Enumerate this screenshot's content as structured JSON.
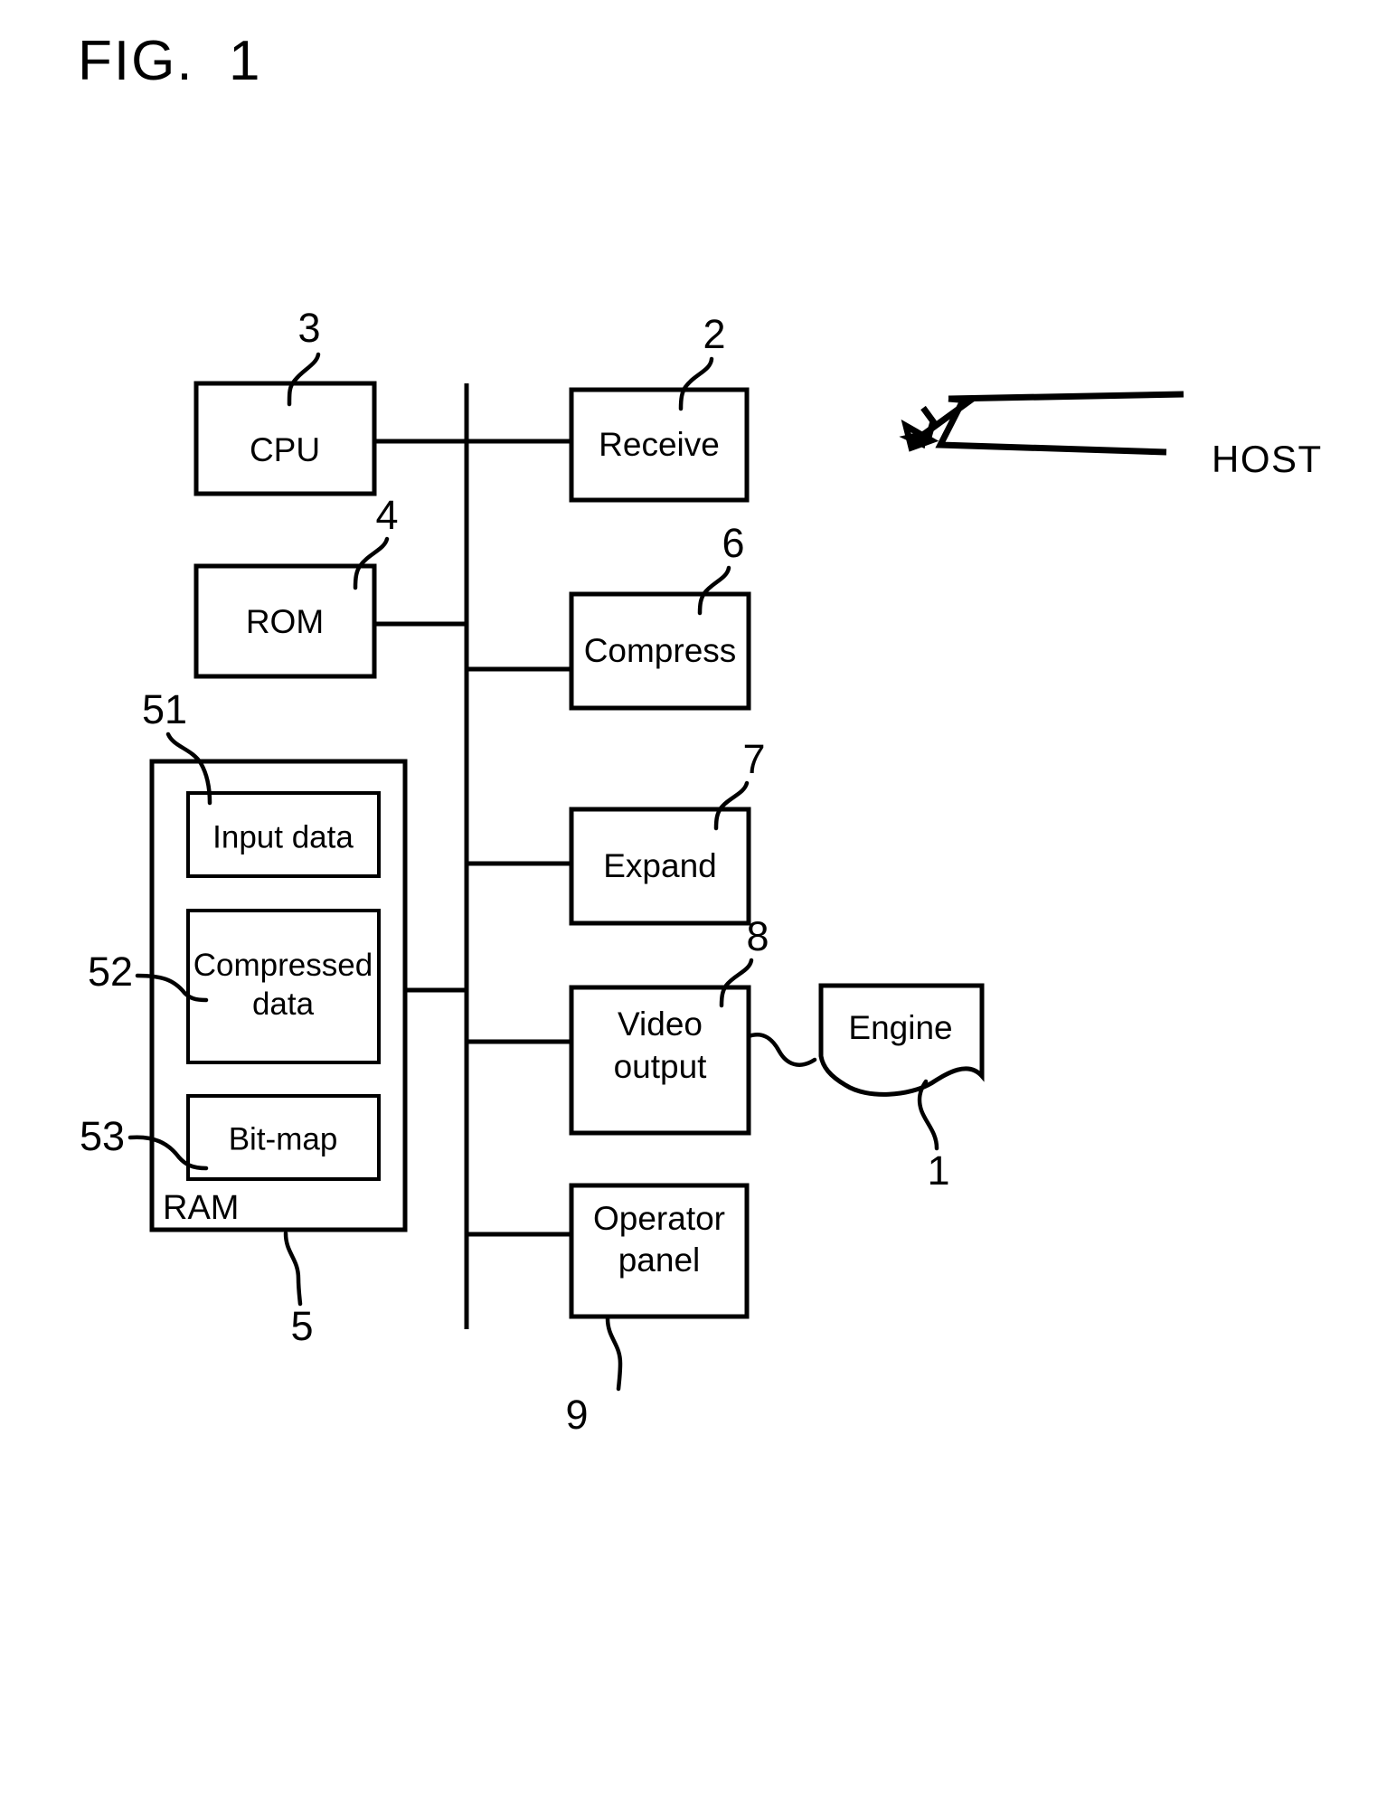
{
  "figure": {
    "title": "FIG.  1",
    "caption_number": "1"
  },
  "external": {
    "host_label": "HOST"
  },
  "blocks": [
    {
      "id": "cpu",
      "label": "CPU",
      "ref": "3"
    },
    {
      "id": "rom",
      "label": "ROM",
      "ref": "4"
    },
    {
      "id": "receive",
      "label": "Receive",
      "ref": "2"
    },
    {
      "id": "compress",
      "label": "Compress",
      "ref": "6"
    },
    {
      "id": "expand",
      "label": "Expand",
      "ref": "7"
    },
    {
      "id": "video_output",
      "label_line1": "Video",
      "label_line2": "output",
      "ref": "8"
    },
    {
      "id": "engine",
      "label": "Engine",
      "ref": "1"
    },
    {
      "id": "operator_panel",
      "label_line1": "Operator",
      "label_line2": "panel",
      "ref": "9"
    }
  ],
  "memory": {
    "container_label": "RAM",
    "container_ref": "5",
    "regions": [
      {
        "id": "input_data",
        "label": "Input data",
        "ref": "51"
      },
      {
        "id": "compressed_data",
        "label_line1": "Compressed",
        "label_line2": "data",
        "ref": "52"
      },
      {
        "id": "bitmap",
        "label": "Bit-map",
        "ref": "53"
      }
    ]
  },
  "colors": {
    "ink": "#000000",
    "paper": "#ffffff"
  }
}
